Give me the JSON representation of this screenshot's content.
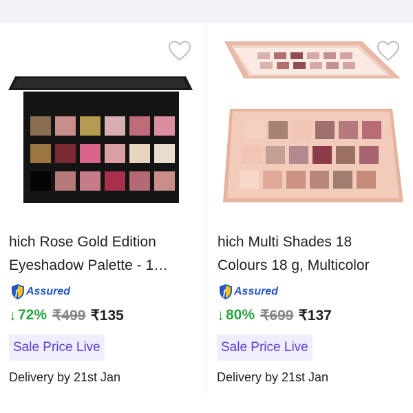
{
  "products": [
    {
      "brand": "hich",
      "title_line1": "Rose Gold Edition",
      "title_line2": "Eyeshadow Palette - 1…",
      "assured_label": "Assured",
      "discount": "72%",
      "mrp": "₹499",
      "price": "₹135",
      "badge": "Sale Price Live",
      "delivery": "Delivery by 21st Jan",
      "icon": "heart-outline-icon"
    },
    {
      "brand": "hich",
      "title_line1": "Multi Shades 18",
      "title_line2": "Colours 18 g, Multicolor",
      "assured_label": "Assured",
      "discount": "80%",
      "mrp": "₹699",
      "price": "₹137",
      "badge": "Sale Price Live",
      "delivery": "Delivery by 21st Jan",
      "icon": "heart-outline-icon"
    }
  ],
  "colors": {
    "discount_green": "#26a541",
    "assured_blue": "#2455c3",
    "badge_bg": "#f0eefe",
    "badge_text": "#5b3fd0"
  }
}
